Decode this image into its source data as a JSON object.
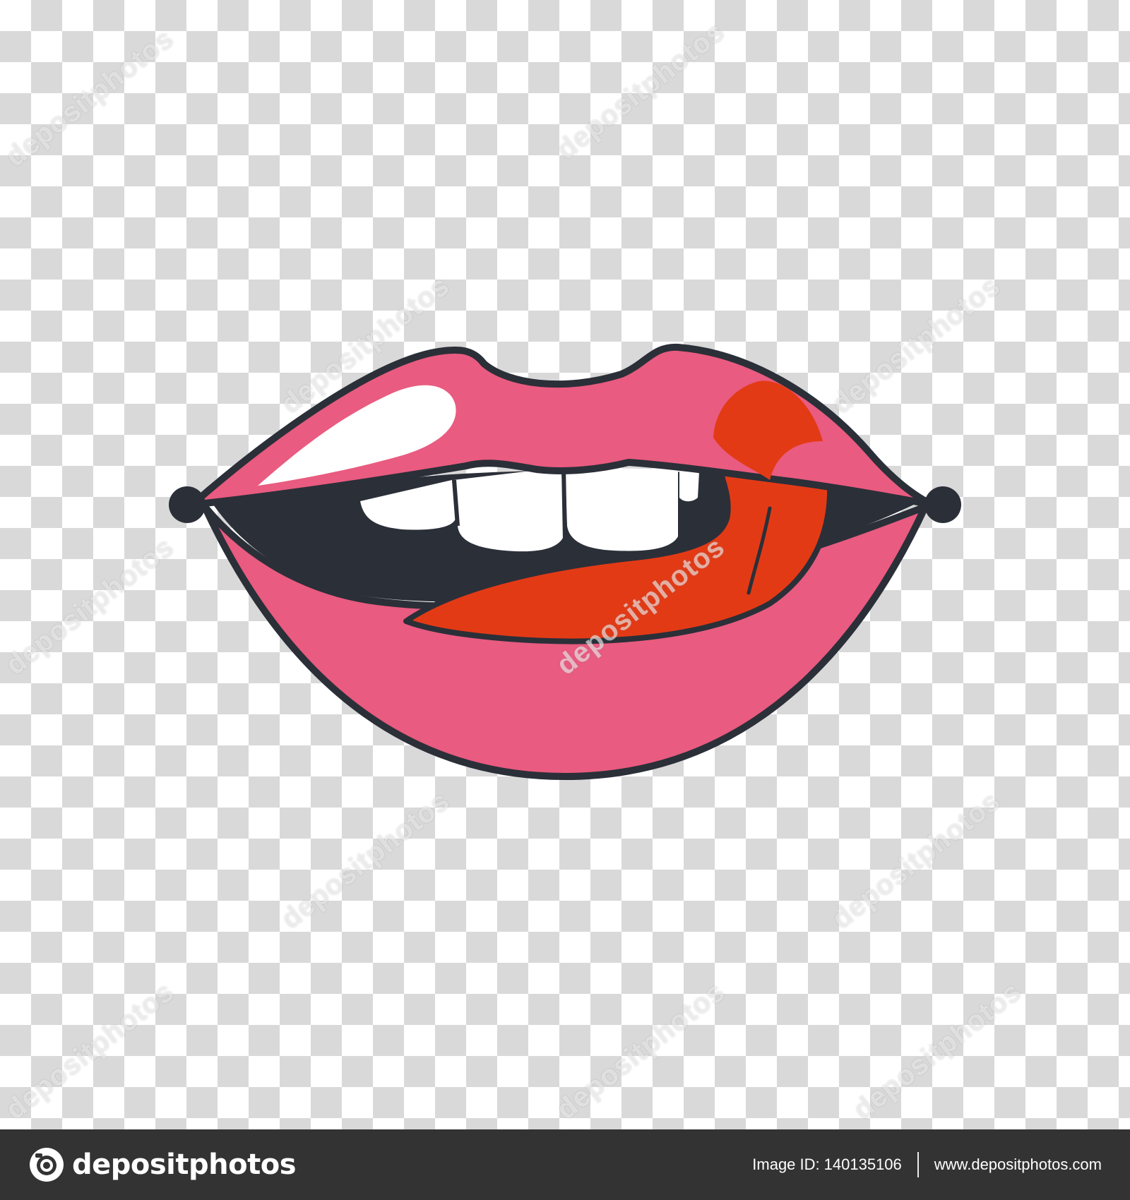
{
  "brand": {
    "name": "depositphotos",
    "watermark_text": "depositphotos"
  },
  "footer": {
    "image_id_label": "Image ID:",
    "image_id": "140135106",
    "site": "www.depositphotos.com"
  },
  "colors": {
    "lip_pink": "#e95b80",
    "tongue_red": "#e33a16",
    "outline": "#2b2f38",
    "teeth": "#ffffff",
    "footer_bg": "#333333"
  }
}
